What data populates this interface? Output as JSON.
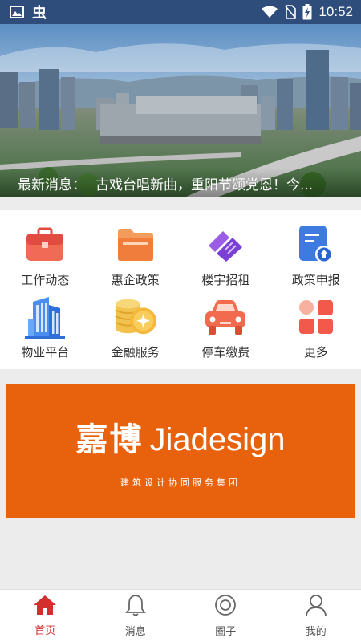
{
  "status_bar": {
    "time": "10:52",
    "carrier_glyph": "虫"
  },
  "banner": {
    "news_label": "最新消息：",
    "news_text": "古戏台唱新曲，重阳节颂党恩！今..."
  },
  "grid": [
    {
      "label": "工作动态",
      "icon": "briefcase-icon"
    },
    {
      "label": "惠企政策",
      "icon": "folder-icon"
    },
    {
      "label": "楼宇招租",
      "icon": "handshake-icon"
    },
    {
      "label": "政策申报",
      "icon": "document-upload-icon"
    },
    {
      "label": "物业平台",
      "icon": "building-icon"
    },
    {
      "label": "金融服务",
      "icon": "coins-icon"
    },
    {
      "label": "停车缴费",
      "icon": "car-icon"
    },
    {
      "label": "更多",
      "icon": "more-grid-icon"
    }
  ],
  "ad": {
    "brand_cn": "嘉博",
    "brand_en": "Jiadesign",
    "subtitle": "建筑设计协同服务集团"
  },
  "nav": [
    {
      "label": "首页",
      "icon": "home-icon",
      "active": true
    },
    {
      "label": "消息",
      "icon": "bell-icon"
    },
    {
      "label": "圈子",
      "icon": "circle-icon"
    },
    {
      "label": "我的",
      "icon": "user-icon"
    }
  ],
  "colors": {
    "status_bar": "#2f4d7a",
    "active": "#d32f2f",
    "ad": "#e8620d"
  }
}
